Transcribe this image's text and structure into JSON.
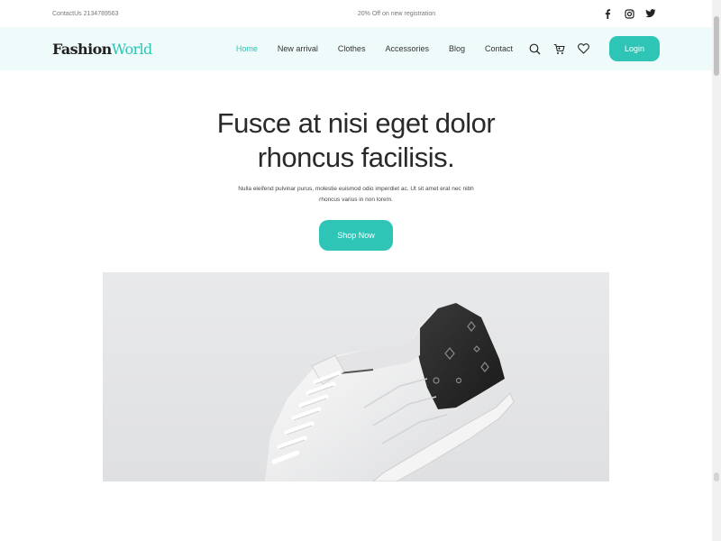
{
  "topbar": {
    "contact": "ContactUs 2134789563",
    "promo": "20% Off on new registration",
    "socials": [
      "facebook-icon",
      "instagram-icon",
      "twitter-icon"
    ]
  },
  "navbar": {
    "logo_main": "Fashion",
    "logo_accent": "World",
    "links": [
      {
        "label": "Home",
        "active": true
      },
      {
        "label": "New arrival"
      },
      {
        "label": "Clothes"
      },
      {
        "label": "Accessories"
      },
      {
        "label": "Blog"
      },
      {
        "label": "Contact"
      }
    ],
    "icons": [
      "search-icon",
      "cart-icon",
      "heart-icon"
    ],
    "login_label": "Login"
  },
  "hero": {
    "title_line1": "Fusce at nisi eget dolor",
    "title_line2": "rhoncus facilisis.",
    "subtitle_line1": "Nulla eleifend pulvinar purus, molestie euismod odio imperdiet ac. Ut sit amet erat nec nibh",
    "subtitle_line2": "rhoncus varius in non lorem.",
    "cta_label": "Shop Now",
    "image_subject": "white sneaker with monogram heel"
  },
  "colors": {
    "accent": "#2ec4b6",
    "nav_bg": "#effbfa"
  }
}
